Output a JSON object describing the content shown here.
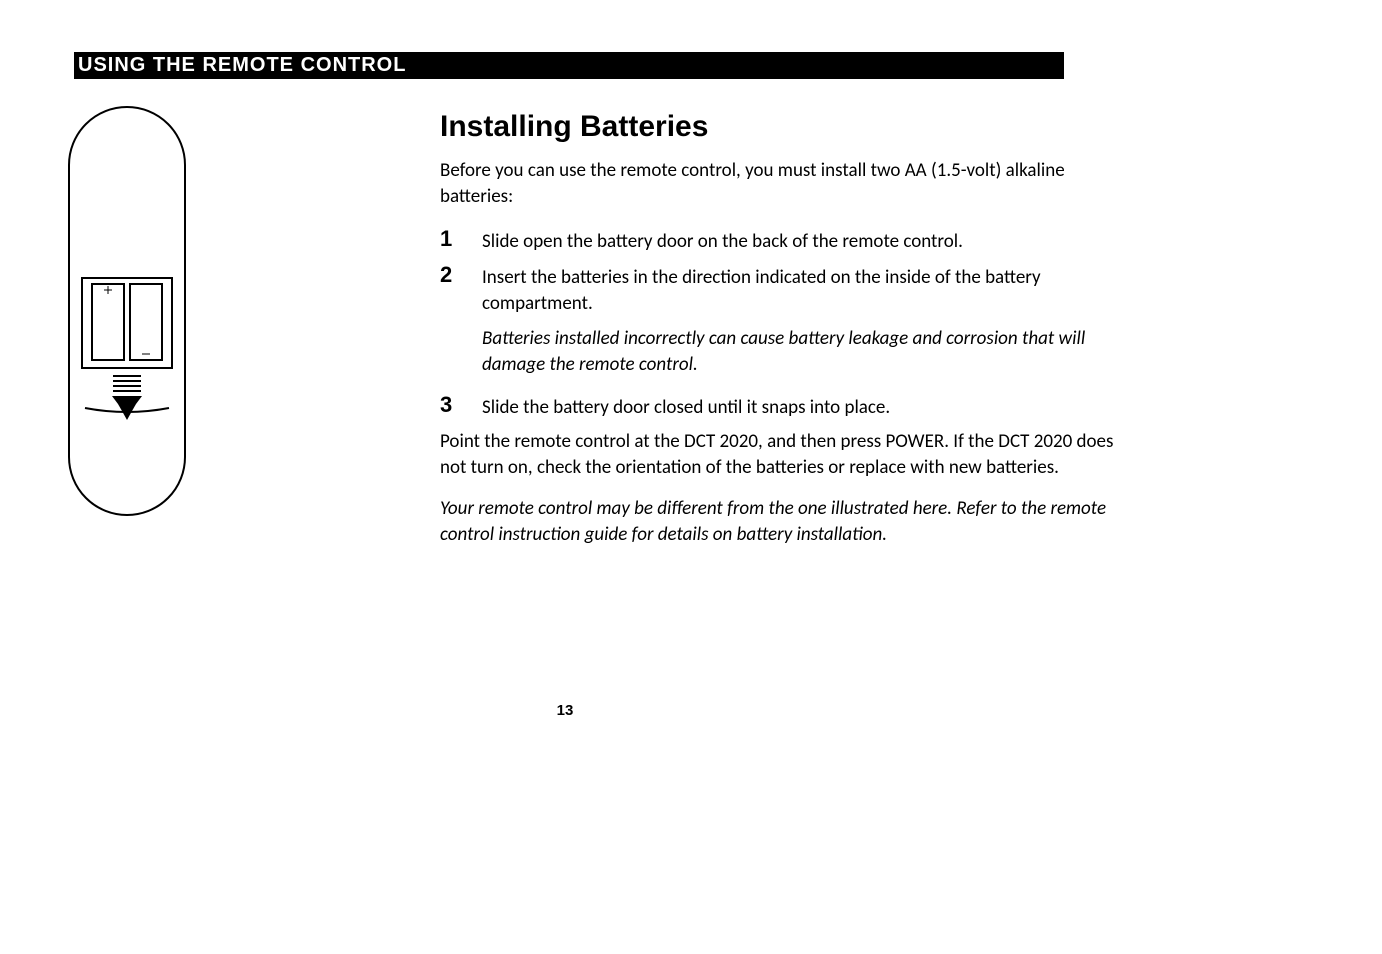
{
  "header": "USING THE REMOTE CONTROL",
  "section_title": "Installing Batteries",
  "intro": "Before you can use the remote control, you must install two AA (1.5-volt) alkaline batteries:",
  "steps": [
    {
      "num": "1",
      "text": "Slide open the battery door on the back of the remote control."
    },
    {
      "num": "2",
      "text": "Insert the batteries in the direction indicated on the inside of the battery compartment.",
      "note": "Batteries installed incorrectly can cause battery leakage and corrosion that will damage the remote control."
    },
    {
      "num": "3",
      "text": "Slide the battery door closed until it snaps into place."
    }
  ],
  "after_prefix": "Point the remote control at the DCT 2020, and then press ",
  "after_key": "POWER",
  "after_suffix": ". If the DCT 2020 does not turn on, check the orientation of the batteries or replace with new batteries.",
  "footnote": "Your remote control may be different from the one illustrated here. Refer to the remote control instruction guide for details on battery installation.",
  "page_number": "13"
}
